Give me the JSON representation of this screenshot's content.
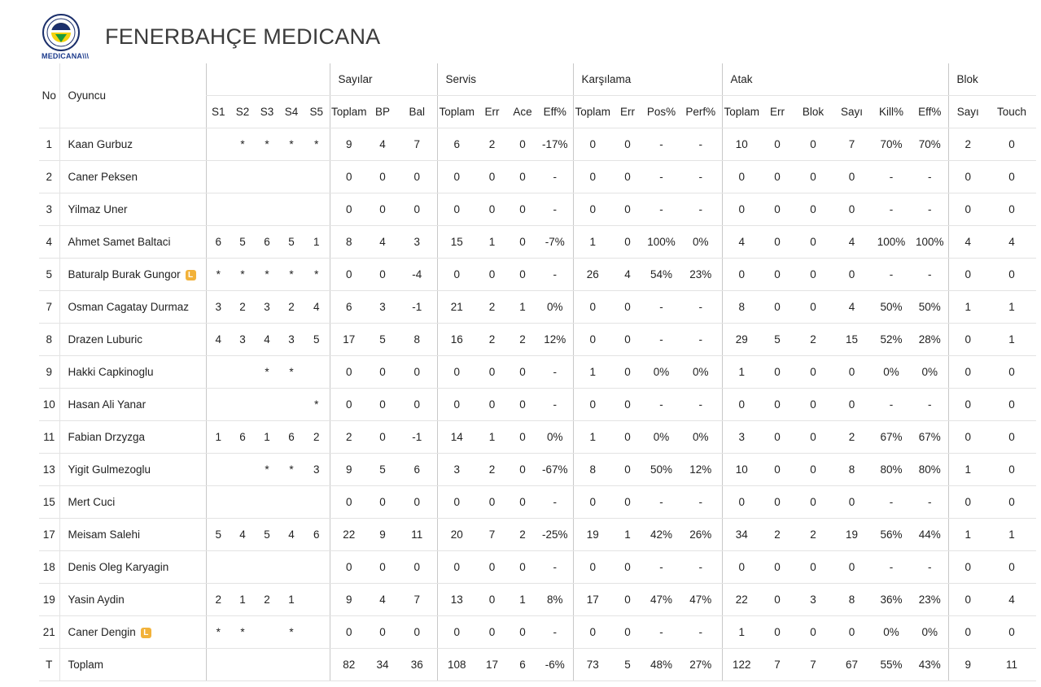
{
  "header": {
    "title": "FENERBAHÇE MEDICANA",
    "logo_text": "MEDICANA\\\\\\"
  },
  "columns": {
    "no": "No",
    "player": "Oyuncu",
    "sets": [
      "S1",
      "S2",
      "S3",
      "S4",
      "S5"
    ],
    "groups": {
      "sayilar": "Sayılar",
      "servis": "Servis",
      "karsilama": "Karşılama",
      "atak": "Atak",
      "blok": "Blok"
    },
    "sayilar": [
      "Toplam",
      "BP",
      "Bal"
    ],
    "servis": [
      "Toplam",
      "Err",
      "Ace",
      "Eff%"
    ],
    "karsilama": [
      "Toplam",
      "Err",
      "Pos%",
      "Perf%"
    ],
    "atak": [
      "Toplam",
      "Err",
      "Blok",
      "Sayı",
      "Kill%",
      "Eff%"
    ],
    "blok": [
      "Sayı",
      "Touch"
    ]
  },
  "libero_badge": "L",
  "rows": [
    {
      "no": "1",
      "name": "Kaan Gurbuz",
      "libero": false,
      "sets": [
        "",
        "*",
        "*",
        "*",
        "*"
      ],
      "sayilar": [
        "9",
        "4",
        "7"
      ],
      "servis": [
        "6",
        "2",
        "0",
        "-17%"
      ],
      "karsilama": [
        "0",
        "0",
        "-",
        "-"
      ],
      "atak": [
        "10",
        "0",
        "0",
        "7",
        "70%",
        "70%"
      ],
      "blok": [
        "2",
        "0"
      ]
    },
    {
      "no": "2",
      "name": "Caner Peksen",
      "libero": false,
      "sets": [
        "",
        "",
        "",
        "",
        ""
      ],
      "sayilar": [
        "0",
        "0",
        "0"
      ],
      "servis": [
        "0",
        "0",
        "0",
        "-"
      ],
      "karsilama": [
        "0",
        "0",
        "-",
        "-"
      ],
      "atak": [
        "0",
        "0",
        "0",
        "0",
        "-",
        "-"
      ],
      "blok": [
        "0",
        "0"
      ]
    },
    {
      "no": "3",
      "name": "Yilmaz Uner",
      "libero": false,
      "sets": [
        "",
        "",
        "",
        "",
        ""
      ],
      "sayilar": [
        "0",
        "0",
        "0"
      ],
      "servis": [
        "0",
        "0",
        "0",
        "-"
      ],
      "karsilama": [
        "0",
        "0",
        "-",
        "-"
      ],
      "atak": [
        "0",
        "0",
        "0",
        "0",
        "-",
        "-"
      ],
      "blok": [
        "0",
        "0"
      ]
    },
    {
      "no": "4",
      "name": "Ahmet Samet Baltaci",
      "libero": false,
      "sets": [
        "6",
        "5",
        "6",
        "5",
        "1"
      ],
      "sayilar": [
        "8",
        "4",
        "3"
      ],
      "servis": [
        "15",
        "1",
        "0",
        "-7%"
      ],
      "karsilama": [
        "1",
        "0",
        "100%",
        "0%"
      ],
      "atak": [
        "4",
        "0",
        "0",
        "4",
        "100%",
        "100%"
      ],
      "blok": [
        "4",
        "4"
      ]
    },
    {
      "no": "5",
      "name": "Baturalp Burak Gungor",
      "libero": true,
      "sets": [
        "*",
        "*",
        "*",
        "*",
        "*"
      ],
      "sayilar": [
        "0",
        "0",
        "-4"
      ],
      "servis": [
        "0",
        "0",
        "0",
        "-"
      ],
      "karsilama": [
        "26",
        "4",
        "54%",
        "23%"
      ],
      "atak": [
        "0",
        "0",
        "0",
        "0",
        "-",
        "-"
      ],
      "blok": [
        "0",
        "0"
      ]
    },
    {
      "no": "7",
      "name": "Osman Cagatay Durmaz",
      "libero": false,
      "sets": [
        "3",
        "2",
        "3",
        "2",
        "4"
      ],
      "sayilar": [
        "6",
        "3",
        "-1"
      ],
      "servis": [
        "21",
        "2",
        "1",
        "0%"
      ],
      "karsilama": [
        "0",
        "0",
        "-",
        "-"
      ],
      "atak": [
        "8",
        "0",
        "0",
        "4",
        "50%",
        "50%"
      ],
      "blok": [
        "1",
        "1"
      ]
    },
    {
      "no": "8",
      "name": "Drazen Luburic",
      "libero": false,
      "sets": [
        "4",
        "3",
        "4",
        "3",
        "5"
      ],
      "sayilar": [
        "17",
        "5",
        "8"
      ],
      "servis": [
        "16",
        "2",
        "2",
        "12%"
      ],
      "karsilama": [
        "0",
        "0",
        "-",
        "-"
      ],
      "atak": [
        "29",
        "5",
        "2",
        "15",
        "52%",
        "28%"
      ],
      "blok": [
        "0",
        "1"
      ]
    },
    {
      "no": "9",
      "name": "Hakki Capkinoglu",
      "libero": false,
      "sets": [
        "",
        "",
        "*",
        "*",
        ""
      ],
      "sayilar": [
        "0",
        "0",
        "0"
      ],
      "servis": [
        "0",
        "0",
        "0",
        "-"
      ],
      "karsilama": [
        "1",
        "0",
        "0%",
        "0%"
      ],
      "atak": [
        "1",
        "0",
        "0",
        "0",
        "0%",
        "0%"
      ],
      "blok": [
        "0",
        "0"
      ]
    },
    {
      "no": "10",
      "name": "Hasan Ali Yanar",
      "libero": false,
      "sets": [
        "",
        "",
        "",
        "",
        "*"
      ],
      "sayilar": [
        "0",
        "0",
        "0"
      ],
      "servis": [
        "0",
        "0",
        "0",
        "-"
      ],
      "karsilama": [
        "0",
        "0",
        "-",
        "-"
      ],
      "atak": [
        "0",
        "0",
        "0",
        "0",
        "-",
        "-"
      ],
      "blok": [
        "0",
        "0"
      ]
    },
    {
      "no": "11",
      "name": "Fabian Drzyzga",
      "libero": false,
      "sets": [
        "1",
        "6",
        "1",
        "6",
        "2"
      ],
      "sayilar": [
        "2",
        "0",
        "-1"
      ],
      "servis": [
        "14",
        "1",
        "0",
        "0%"
      ],
      "karsilama": [
        "1",
        "0",
        "0%",
        "0%"
      ],
      "atak": [
        "3",
        "0",
        "0",
        "2",
        "67%",
        "67%"
      ],
      "blok": [
        "0",
        "0"
      ]
    },
    {
      "no": "13",
      "name": "Yigit Gulmezoglu",
      "libero": false,
      "sets": [
        "",
        "",
        "*",
        "*",
        "3"
      ],
      "sayilar": [
        "9",
        "5",
        "6"
      ],
      "servis": [
        "3",
        "2",
        "0",
        "-67%"
      ],
      "karsilama": [
        "8",
        "0",
        "50%",
        "12%"
      ],
      "atak": [
        "10",
        "0",
        "0",
        "8",
        "80%",
        "80%"
      ],
      "blok": [
        "1",
        "0"
      ]
    },
    {
      "no": "15",
      "name": "Mert Cuci",
      "libero": false,
      "sets": [
        "",
        "",
        "",
        "",
        ""
      ],
      "sayilar": [
        "0",
        "0",
        "0"
      ],
      "servis": [
        "0",
        "0",
        "0",
        "-"
      ],
      "karsilama": [
        "0",
        "0",
        "-",
        "-"
      ],
      "atak": [
        "0",
        "0",
        "0",
        "0",
        "-",
        "-"
      ],
      "blok": [
        "0",
        "0"
      ]
    },
    {
      "no": "17",
      "name": "Meisam Salehi",
      "libero": false,
      "sets": [
        "5",
        "4",
        "5",
        "4",
        "6"
      ],
      "sayilar": [
        "22",
        "9",
        "11"
      ],
      "servis": [
        "20",
        "7",
        "2",
        "-25%"
      ],
      "karsilama": [
        "19",
        "1",
        "42%",
        "26%"
      ],
      "atak": [
        "34",
        "2",
        "2",
        "19",
        "56%",
        "44%"
      ],
      "blok": [
        "1",
        "1"
      ]
    },
    {
      "no": "18",
      "name": "Denis Oleg Karyagin",
      "libero": false,
      "sets": [
        "",
        "",
        "",
        "",
        ""
      ],
      "sayilar": [
        "0",
        "0",
        "0"
      ],
      "servis": [
        "0",
        "0",
        "0",
        "-"
      ],
      "karsilama": [
        "0",
        "0",
        "-",
        "-"
      ],
      "atak": [
        "0",
        "0",
        "0",
        "0",
        "-",
        "-"
      ],
      "blok": [
        "0",
        "0"
      ]
    },
    {
      "no": "19",
      "name": "Yasin Aydin",
      "libero": false,
      "sets": [
        "2",
        "1",
        "2",
        "1",
        ""
      ],
      "sayilar": [
        "9",
        "4",
        "7"
      ],
      "servis": [
        "13",
        "0",
        "1",
        "8%"
      ],
      "karsilama": [
        "17",
        "0",
        "47%",
        "47%"
      ],
      "atak": [
        "22",
        "0",
        "3",
        "8",
        "36%",
        "23%"
      ],
      "blok": [
        "0",
        "4"
      ]
    },
    {
      "no": "21",
      "name": "Caner Dengin",
      "libero": true,
      "sets": [
        "*",
        "*",
        "",
        "*",
        ""
      ],
      "sayilar": [
        "0",
        "0",
        "0"
      ],
      "servis": [
        "0",
        "0",
        "0",
        "-"
      ],
      "karsilama": [
        "0",
        "0",
        "-",
        "-"
      ],
      "atak": [
        "1",
        "0",
        "0",
        "0",
        "0%",
        "0%"
      ],
      "blok": [
        "0",
        "0"
      ]
    }
  ],
  "total": {
    "no": "T",
    "name": "Toplam",
    "sayilar": [
      "82",
      "34",
      "36"
    ],
    "servis": [
      "108",
      "17",
      "6",
      "-6%"
    ],
    "karsilama": [
      "73",
      "5",
      "48%",
      "27%"
    ],
    "atak": [
      "122",
      "7",
      "7",
      "67",
      "55%",
      "43%"
    ],
    "blok": [
      "9",
      "11"
    ]
  }
}
